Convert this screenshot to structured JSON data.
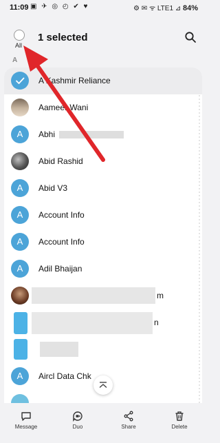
{
  "status_bar": {
    "time": "11:09",
    "notifications": "▣ ✈ ◎ ◴ ✔ ♥",
    "indicators": "⚙ ✉ ᯤ LTE1 ⊿",
    "battery": "84%"
  },
  "header": {
    "select_all_label": "All",
    "title": "1 selected"
  },
  "section_letter": "A",
  "contacts": [
    {
      "name": "A Kashmir Reliance",
      "avatar": "check",
      "selected": true
    },
    {
      "name": "Aameer Wani",
      "avatar": "photo",
      "selected": false
    },
    {
      "name": "Abhi",
      "avatar": "A",
      "selected": false
    },
    {
      "name": "Abid Rashid",
      "avatar": "photo",
      "selected": false
    },
    {
      "name": "Abid V3",
      "avatar": "A",
      "selected": false
    },
    {
      "name": "Account Info",
      "avatar": "A",
      "selected": false
    },
    {
      "name": "Account Info",
      "avatar": "A",
      "selected": false
    },
    {
      "name": "Adil Bhaijan",
      "avatar": "A",
      "selected": false
    },
    {
      "name": "m",
      "avatar": "photo",
      "selected": false
    },
    {
      "name": "n",
      "avatar": "blurred",
      "selected": false
    },
    {
      "name": "",
      "avatar": "blurred",
      "selected": false
    },
    {
      "name": "Aircl Data Chk",
      "avatar": "A",
      "selected": false
    }
  ],
  "bottom_actions": [
    {
      "label": "Message",
      "icon": "message-icon"
    },
    {
      "label": "Duo",
      "icon": "duo-icon"
    },
    {
      "label": "Share",
      "icon": "share-icon"
    },
    {
      "label": "Delete",
      "icon": "delete-icon"
    }
  ],
  "colors": {
    "accent": "#4ca4d8",
    "background": "#f2f2f4",
    "annotation_arrow": "#e0262a"
  }
}
